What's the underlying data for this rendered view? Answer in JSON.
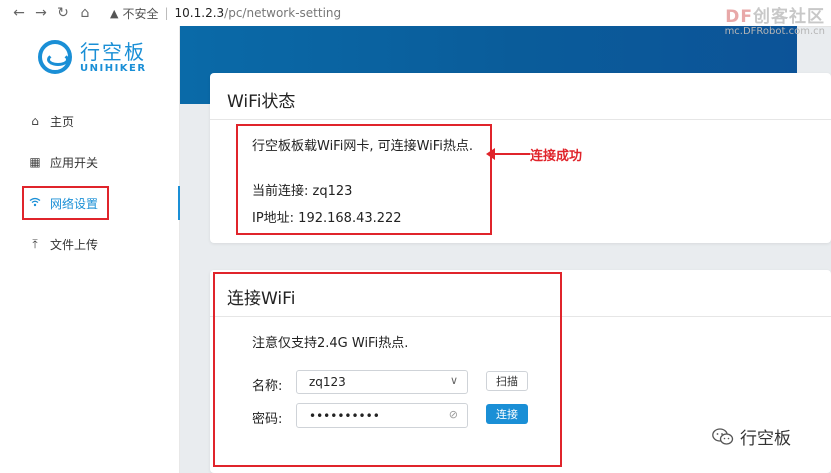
{
  "browser": {
    "back_icon": "arrow-left-icon",
    "forward_icon": "arrow-right-icon",
    "reload_icon": "reload-icon",
    "home_icon": "home-icon",
    "security_label": "不安全",
    "url_host": "10.1.2.3",
    "url_path": "/pc/network-setting"
  },
  "sidebar": {
    "logo": {
      "name": "行空板",
      "subtitle": "UNIHIKER"
    },
    "items": [
      {
        "label": "主页",
        "icon": "home-icon"
      },
      {
        "label": "应用开关",
        "icon": "grid-icon"
      },
      {
        "label": "网络设置",
        "icon": "wifi-icon",
        "active": true
      },
      {
        "label": "文件上传",
        "icon": "upload-icon"
      }
    ]
  },
  "wifi_status": {
    "title": "WiFi状态",
    "description": "行空板板载WiFi网卡, 可连接WiFi热点.",
    "current_connection": "当前连接: zq123",
    "ip_address": "IP地址: 192.168.43.222",
    "annotation": "连接成功"
  },
  "connect_wifi": {
    "title": "连接WiFi",
    "note": "注意仅支持2.4G WiFi热点.",
    "name_label": "名称:",
    "ssid_value": "zq123",
    "password_label": "密码:",
    "password_value": "••••••••••",
    "scan_button": "扫描",
    "connect_button": "连接"
  },
  "watermarks": {
    "site_df": "DF",
    "site_name": "创客社区",
    "site_url": "mc.DFRobot.com.cn",
    "wechat_name": "行空板"
  },
  "colors": {
    "accent": "#1a8fd6",
    "annotation_red": "#e0242b",
    "banner": "#0a6aa8"
  }
}
